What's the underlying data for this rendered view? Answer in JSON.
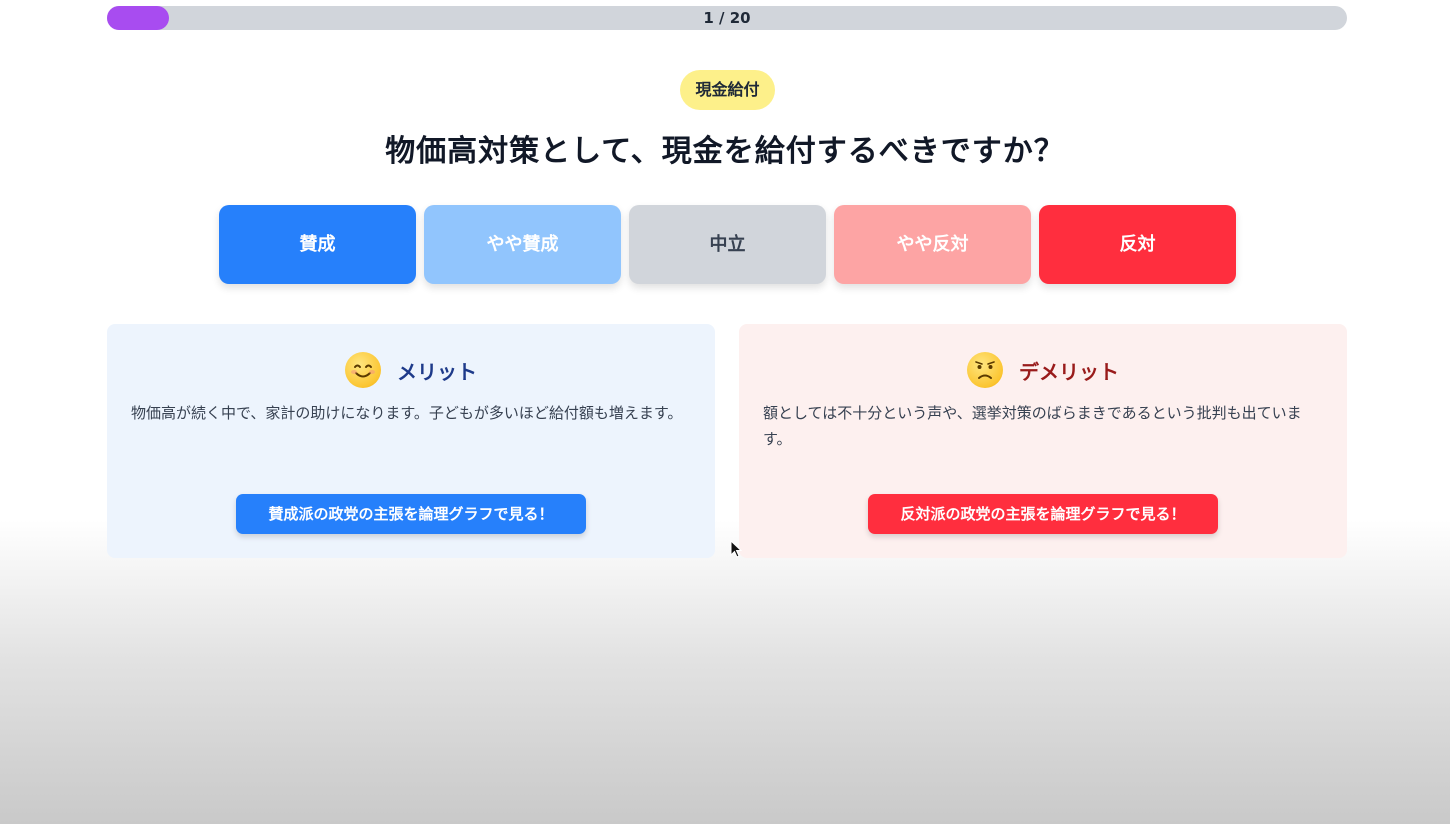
{
  "progress": {
    "label": "1 / 20",
    "current": 1,
    "total": 20,
    "fill_fraction": 0.05,
    "fill_color": "#a84cf0"
  },
  "category": "現金給付",
  "question": "物価高対策として、現金を給付するべきですか？",
  "answers": [
    {
      "label": "賛成",
      "color": "#2680fb"
    },
    {
      "label": "やや賛成",
      "color": "#91c5fd"
    },
    {
      "label": "中立",
      "color": "#d1d5db"
    },
    {
      "label": "やや反対",
      "color": "#fda4a4"
    },
    {
      "label": "反対",
      "color": "#ff2e3e"
    }
  ],
  "merit": {
    "icon": "smiling-face-icon",
    "title": "メリット",
    "body": "物価高が続く中で、家計の助けになります。子どもが多いほど給付額も増えます。",
    "button": "賛成派の政党の主張を論理グラフで見る！"
  },
  "demerit": {
    "icon": "worried-face-icon",
    "title": "デメリット",
    "body": "額としては不十分という声や、選挙対策のばらまきであるという批判も出ています。",
    "button": "反対派の政党の主張を論理グラフで見る！"
  }
}
